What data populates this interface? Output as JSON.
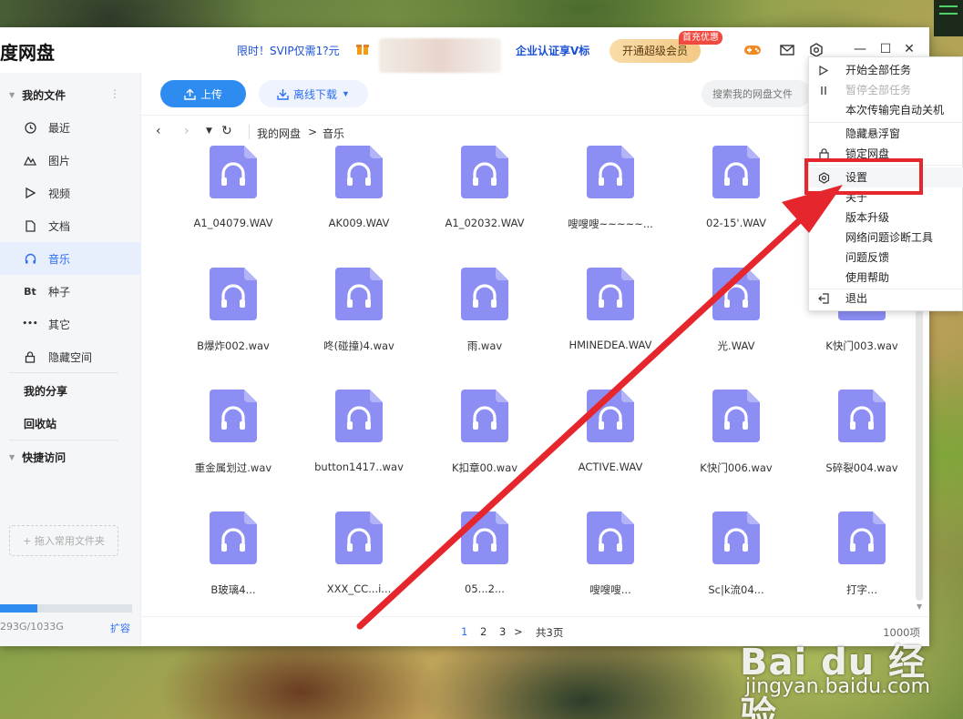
{
  "window": {
    "title": "度网盘",
    "promo": "限时！SVIP仅需1?元",
    "enterprise": "企业认证享V标",
    "vip_button": "开通超级会员",
    "vip_badge": "首充优惠",
    "window_controls": {
      "minimize": "—",
      "maximize": "☐",
      "close": "✕"
    }
  },
  "sidebar": {
    "my_files": "我的文件",
    "items": [
      {
        "label": "最近",
        "icon": "clock-icon"
      },
      {
        "label": "图片",
        "icon": "mountain-icon"
      },
      {
        "label": "视频",
        "icon": "play-icon"
      },
      {
        "label": "文档",
        "icon": "document-icon"
      },
      {
        "label": "音乐",
        "icon": "headphones-icon"
      },
      {
        "label": "种子",
        "icon": "bt-icon",
        "glyph": "Bt"
      },
      {
        "label": "其它",
        "icon": "more-dots-icon",
        "glyph": "•••"
      },
      {
        "label": "隐藏空间",
        "icon": "lock-icon"
      }
    ],
    "my_share": "我的分享",
    "recycle_bin": "回收站",
    "quick_access": "快捷访问",
    "drop_hint": "+ 拖入常用文件夹",
    "quota": "293G/1033G",
    "quota_fraction": 0.28,
    "expand": "扩容"
  },
  "toolbar": {
    "upload": "上传",
    "offline_download": "离线下载",
    "search_placeholder": "搜索我的网盘文件"
  },
  "breadcrumb": {
    "root": "我的网盘",
    "separator": ">",
    "current": "音乐"
  },
  "files": [
    "A1_04079.WAV",
    "AK009.WAV",
    "A1_02032.WAV",
    "嗖嗖嗖~~~~~...",
    "02-15'.WAV",
    "",
    "B爆炸002.wav",
    "咚(碰撞)4.wav",
    "雨.wav",
    "HMINEDEA.WAV",
    "光.WAV",
    "K快门003.wav",
    "重金属划过.wav",
    "button1417..wav",
    "K扣章00.wav",
    "ACTIVE.WAV",
    "K快门006.wav",
    "S碎裂004.wav",
    "B玻璃4...",
    "XXX_CC...i...",
    "05...2...",
    "嗖嗖嗖...",
    "Sc|k流04...",
    "打字..."
  ],
  "pagination": {
    "pages": [
      "1",
      "2",
      "3"
    ],
    "current": "1",
    "next": ">",
    "total_pages": "共3页",
    "total_items": "1000项"
  },
  "menu": {
    "items": [
      {
        "label": "开始全部任务",
        "icon": "play-outline-icon",
        "disabled": false
      },
      {
        "label": "暂停全部任务",
        "icon": "pause-icon",
        "disabled": true
      },
      {
        "label": "本次传输完自动关机",
        "icon": "",
        "disabled": false
      },
      {
        "label": "隐藏悬浮窗",
        "icon": "",
        "disabled": false
      },
      {
        "label": "锁定网盘",
        "icon": "lock-icon",
        "disabled": false
      },
      {
        "label": "设置",
        "icon": "gear-icon",
        "disabled": false
      },
      {
        "label": "关于",
        "icon": "",
        "disabled": false
      },
      {
        "label": "版本升级",
        "icon": "",
        "disabled": false
      },
      {
        "label": "网络问题诊断工具",
        "icon": "",
        "disabled": false
      },
      {
        "label": "问题反馈",
        "icon": "",
        "disabled": false
      },
      {
        "label": "使用帮助",
        "icon": "",
        "disabled": false
      },
      {
        "label": "退出",
        "icon": "logout-icon",
        "disabled": false
      }
    ]
  },
  "watermark": {
    "main": "Bai du 经验",
    "sub": "jingyan.baidu.com"
  },
  "colors": {
    "accent": "#2e8cf0",
    "file_icon": "#8c8ef3",
    "annotation": "#e5262d",
    "vip_gold": "#f3c985"
  }
}
